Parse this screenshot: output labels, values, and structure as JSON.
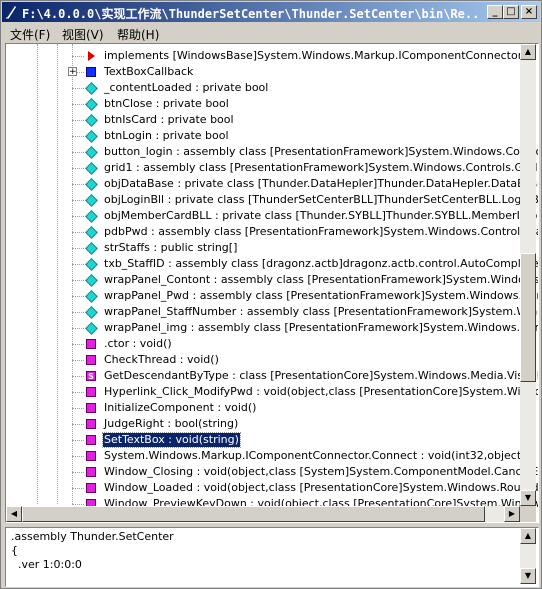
{
  "window": {
    "title": "F:\\4.0.0.0\\实现工作流\\ThunderSetCenter\\Thunder.SetCenter\\bin\\Re...",
    "minimize_glyph": "_",
    "maximize_glyph": "□",
    "close_glyph": "×"
  },
  "menu": [
    {
      "label": "文件(F)"
    },
    {
      "label": "视图(V)"
    },
    {
      "label": "帮助(H)"
    }
  ],
  "tree": {
    "expander_glyph": "+",
    "items": [
      {
        "icon": "red-arrow",
        "text": "implements [WindowsBase]System.Windows.Markup.IComponentConnector"
      },
      {
        "icon": "blue-square",
        "text": "TextBoxCallback",
        "expandable": true
      },
      {
        "icon": "cyan-diamond",
        "text": "_contentLoaded : private bool"
      },
      {
        "icon": "cyan-diamond",
        "text": "btnClose : private bool"
      },
      {
        "icon": "cyan-diamond",
        "text": "btnIsCard : private bool"
      },
      {
        "icon": "cyan-diamond",
        "text": "btnLogin : private bool"
      },
      {
        "icon": "cyan-diamond",
        "text": "button_login : assembly class [PresentationFramework]System.Windows.Controls.Butto"
      },
      {
        "icon": "cyan-diamond",
        "text": "grid1 : assembly class [PresentationFramework]System.Windows.Controls.Grid"
      },
      {
        "icon": "cyan-diamond",
        "text": "objDataBase : private class [Thunder.DataHepler]Thunder.DataHepler.DataBase"
      },
      {
        "icon": "cyan-diamond",
        "text": "objLoginBll : private class [ThunderSetCenterBLL]ThunderSetCenterBLL.LoginBLL"
      },
      {
        "icon": "cyan-diamond",
        "text": "objMemberCardBLL : private class [Thunder.SYBLL]Thunder.SYBLL.MemberInfoBLL.Mem"
      },
      {
        "icon": "cyan-diamond",
        "text": "pdbPwd : assembly class [PresentationFramework]System.Windows.Controls.Password"
      },
      {
        "icon": "cyan-diamond",
        "text": "strStaffs : public string[]"
      },
      {
        "icon": "cyan-diamond",
        "text": "txb_StaffID : assembly class [dragonz.actb]dragonz.actb.control.AutoCompleteCombo"
      },
      {
        "icon": "cyan-diamond",
        "text": "wrapPanel_Contont : assembly class [PresentationFramework]System.Windows.Contro"
      },
      {
        "icon": "cyan-diamond",
        "text": "wrapPanel_Pwd : assembly class [PresentationFramework]System.Windows.Controls.W"
      },
      {
        "icon": "cyan-diamond",
        "text": "wrapPanel_StaffNumber : assembly class [PresentationFramework]System.Windows.Co"
      },
      {
        "icon": "cyan-diamond",
        "text": "wrapPanel_img : assembly class [PresentationFramework]System.Windows.Controls.W"
      },
      {
        "icon": "magenta-square",
        "text": ".ctor : void()"
      },
      {
        "icon": "magenta-square",
        "text": "CheckThread : void()"
      },
      {
        "icon": "static-method",
        "text": "GetDescendantByType : class [PresentationCore]System.Windows.Media.Visual(class ["
      },
      {
        "icon": "magenta-square",
        "text": "Hyperlink_Click_ModifyPwd : void(object,class [PresentationCore]System.Windows.Rou"
      },
      {
        "icon": "magenta-square",
        "text": "InitializeComponent : void()"
      },
      {
        "icon": "magenta-square",
        "text": "JudgeRight : bool(string)"
      },
      {
        "icon": "magenta-square",
        "text": "SetTextBox : void(string)",
        "selected": true
      },
      {
        "icon": "magenta-square",
        "text": "System.Windows.Markup.IComponentConnector.Connect : void(int32,object)"
      },
      {
        "icon": "magenta-square",
        "text": "Window_Closing : void(object,class [System]System.ComponentModel.CancelEventArg"
      },
      {
        "icon": "magenta-square",
        "text": "Window_Loaded : void(object,class [PresentationCore]System.Windows.RoutedEventA"
      },
      {
        "icon": "magenta-square",
        "text": "Window_PreviewKeyDown : void(object,class [PresentationCore]System.Windows.Inpu"
      }
    ],
    "vscroll": {
      "position_fraction": 0.64,
      "visible_fraction": 0.3
    },
    "hscroll": {
      "position_fraction": 0.02,
      "visible_fraction": 0.96
    }
  },
  "detail": {
    "lines": [
      ".assembly Thunder.SetCenter",
      "{",
      "  .ver 1:0:0:0"
    ]
  },
  "glyphs": {
    "up": "▲",
    "down": "▼",
    "left": "◀",
    "right": "▶",
    "static_badge": "S"
  },
  "colors": {
    "selection": "#0a246a",
    "title_start": "#0a246a",
    "title_end": "#a6caf0"
  }
}
